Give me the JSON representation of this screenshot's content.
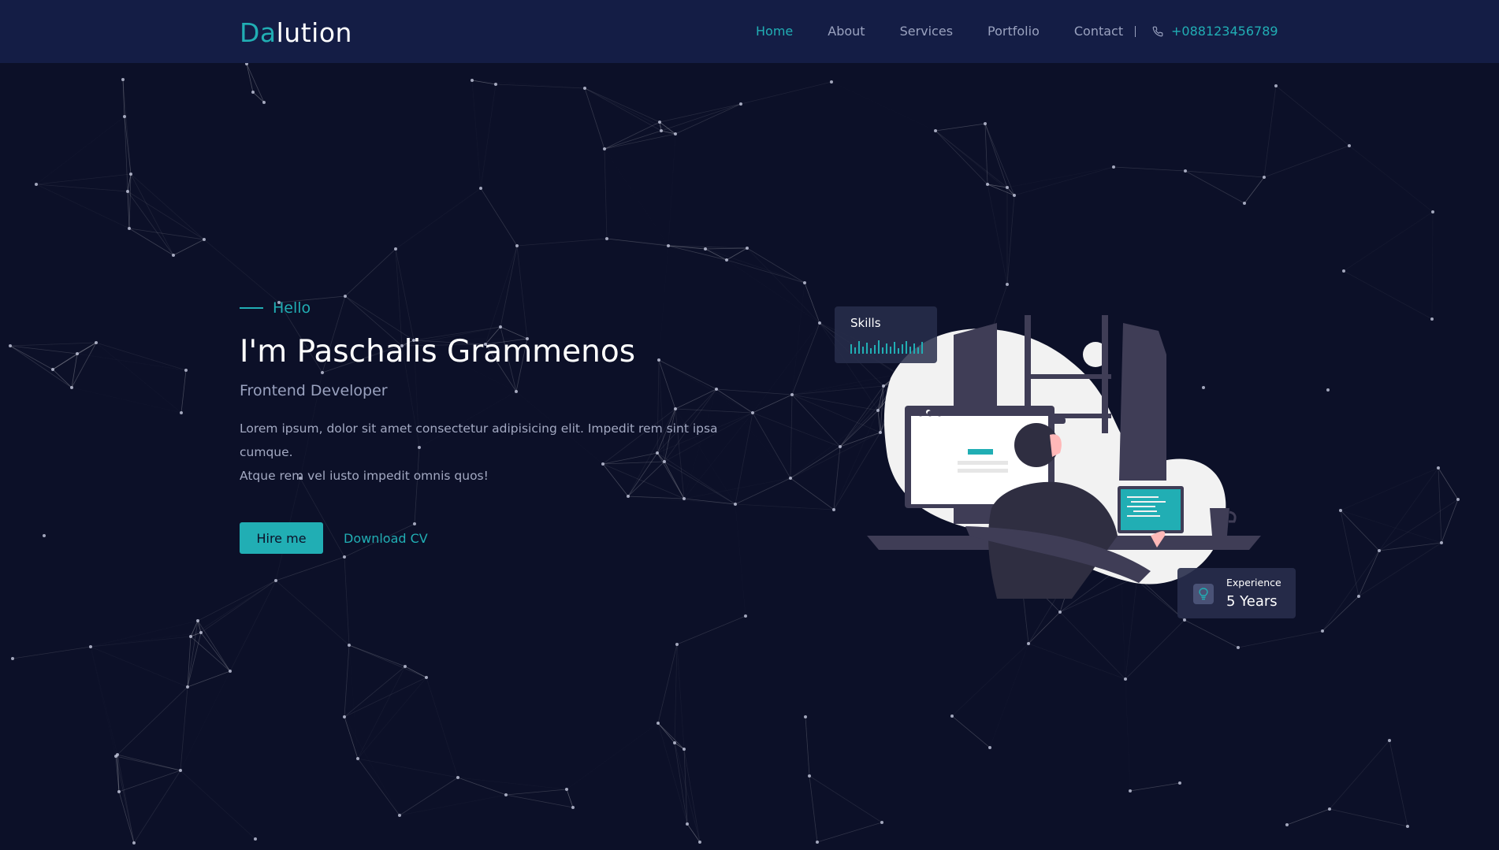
{
  "brand": {
    "logo_accent": "Da",
    "logo_rest": "lution"
  },
  "nav": {
    "items": [
      {
        "label": "Home",
        "active": true
      },
      {
        "label": "About",
        "active": false
      },
      {
        "label": "Services",
        "active": false
      },
      {
        "label": "Portfolio",
        "active": false
      },
      {
        "label": "Contact",
        "active": false
      }
    ],
    "phone": "+088123456789"
  },
  "hero": {
    "greeting": "Hello",
    "name": "I'm Paschalis Grammenos",
    "role": "Frontend Developer",
    "description_line1": "Lorem ipsum, dolor sit amet consectetur adipisicing elit. Impedit rem sint ipsa cumque.",
    "description_line2": "Atque rem vel iusto impedit omnis quos!",
    "hire_label": "Hire me",
    "cv_label": "Download CV"
  },
  "cards": {
    "skills_label": "Skills",
    "experience_label": "Experience",
    "experience_value": "5 Years"
  },
  "colors": {
    "accent": "#21aeb4",
    "background": "#0c1028",
    "header": "#141d45"
  },
  "icons": {
    "phone": "phone-icon",
    "experience": "lightbulb-icon"
  }
}
